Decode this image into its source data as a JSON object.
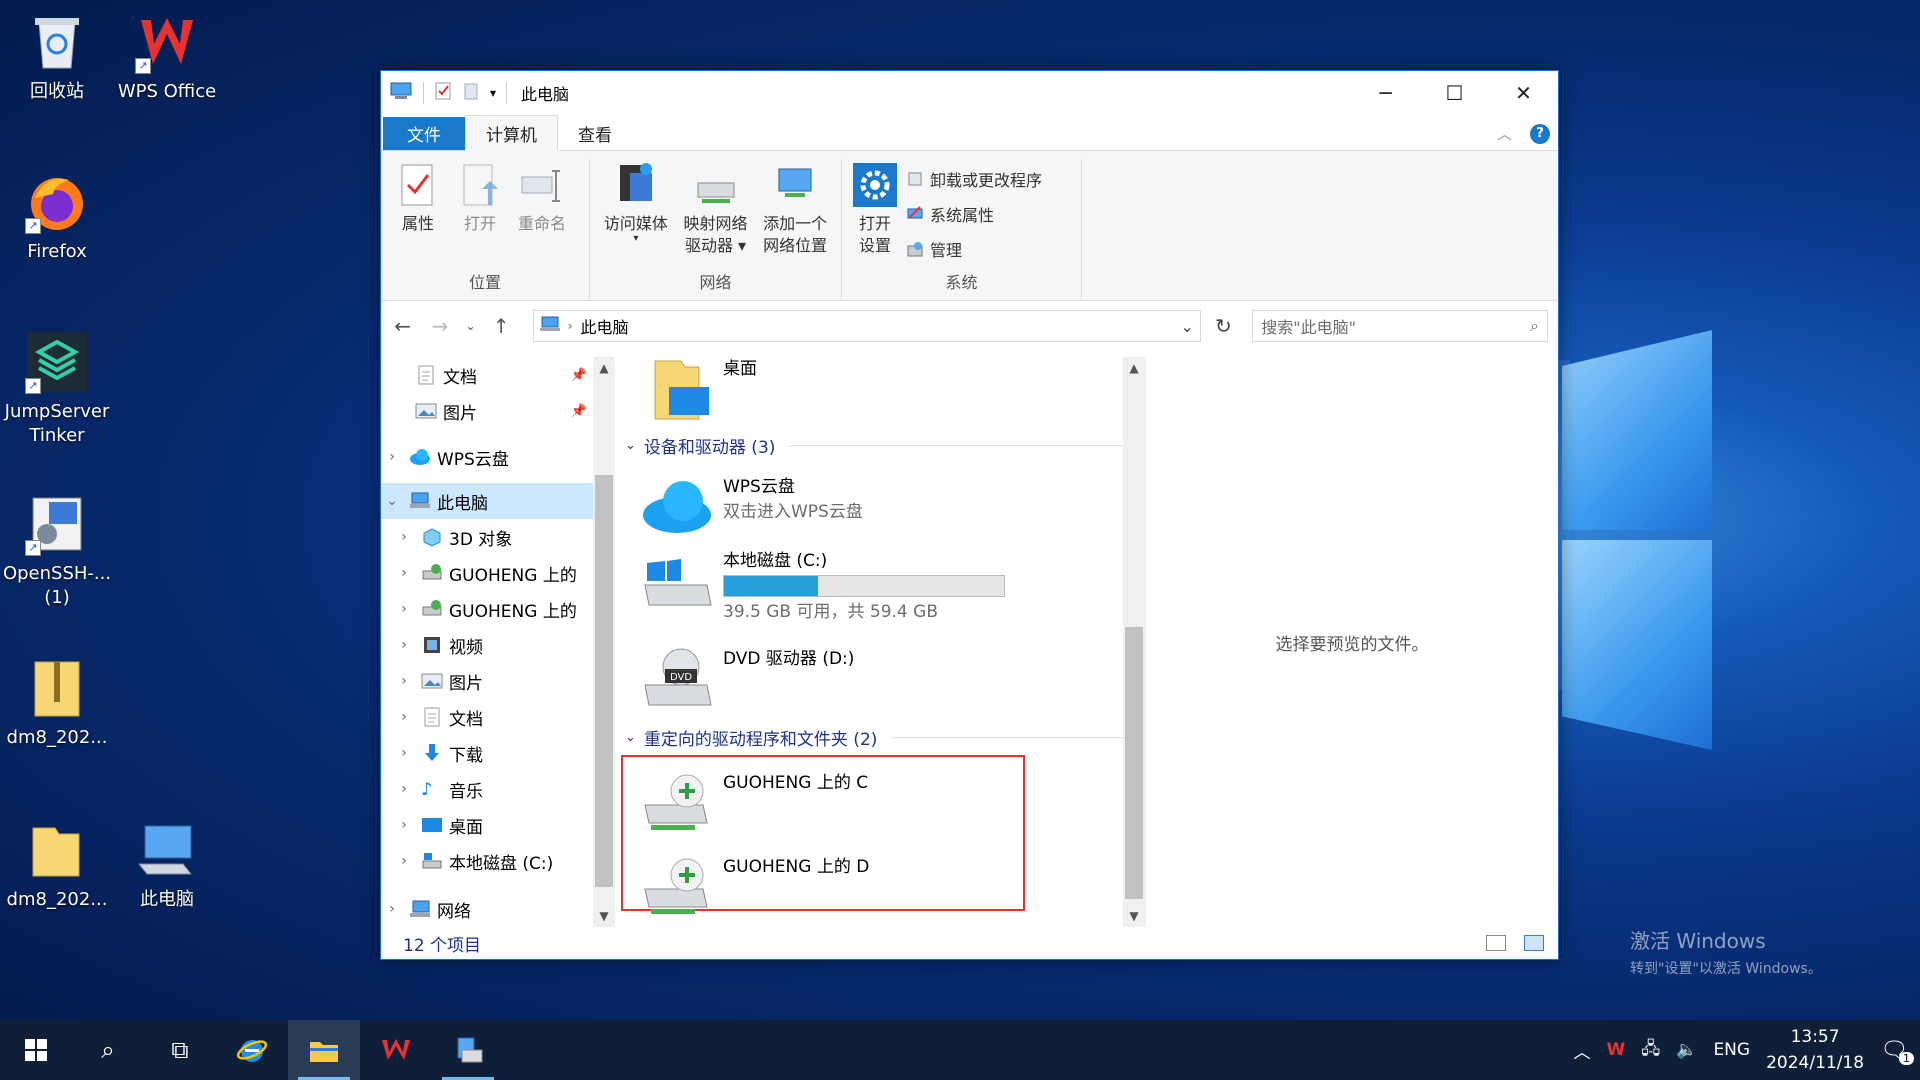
{
  "desktop": {
    "icons": [
      {
        "label": "回收站"
      },
      {
        "label": "WPS Office"
      },
      {
        "label": "Firefox"
      },
      {
        "label": "JumpServer Tinker"
      },
      {
        "label": "OpenSSH-... (1)"
      },
      {
        "label": "dm8_202..."
      },
      {
        "label": "dm8_202..."
      },
      {
        "label": "此电脑"
      }
    ],
    "watermark": {
      "line1": "激活 Windows",
      "line2": "转到\"设置\"以激活 Windows。"
    }
  },
  "window": {
    "title": "此电脑",
    "tabs": {
      "file": "文件",
      "computer": "计算机",
      "view": "查看"
    },
    "ribbon": {
      "location": {
        "label": "位置",
        "properties": "属性",
        "open": "打开",
        "rename": "重命名"
      },
      "network": {
        "label": "网络",
        "media": "访问媒体",
        "map_drive_l1": "映射网络",
        "map_drive_l2": "驱动器",
        "add_loc_l1": "添加一个",
        "add_loc_l2": "网络位置"
      },
      "system": {
        "label": "系统",
        "open_settings_l1": "打开",
        "open_settings_l2": "设置",
        "uninstall": "卸载或更改程序",
        "sys_props": "系统属性",
        "manage": "管理"
      }
    },
    "address": {
      "path": "此电脑",
      "search_placeholder": "搜索\"此电脑\""
    },
    "nav": [
      {
        "label": "文档"
      },
      {
        "label": "图片"
      },
      {
        "label": "WPS云盘"
      },
      {
        "label": "此电脑"
      },
      {
        "label": "3D 对象"
      },
      {
        "label": "GUOHENG 上的"
      },
      {
        "label": "GUOHENG 上的"
      },
      {
        "label": "视频"
      },
      {
        "label": "图片"
      },
      {
        "label": "文档"
      },
      {
        "label": "下载"
      },
      {
        "label": "音乐"
      },
      {
        "label": "桌面"
      },
      {
        "label": "本地磁盘 (C:)"
      },
      {
        "label": "网络"
      }
    ],
    "content": {
      "desktop_folder": "桌面",
      "devices_header": "设备和驱动器 (3)",
      "wps_name": "WPS云盘",
      "wps_sub": "双击进入WPS云盘",
      "c_name": "本地磁盘 (C:)",
      "c_space": "39.5 GB 可用，共 59.4 GB",
      "c_used_fraction": 0.335,
      "dvd_name": "DVD 驱动器 (D:)",
      "redirect_header": "重定向的驱动程序和文件夹 (2)",
      "guoheng_c": "GUOHENG 上的 C",
      "guoheng_d": "GUOHENG 上的 D"
    },
    "preview_text": "选择要预览的文件。",
    "status": "12 个项目"
  },
  "taskbar": {
    "lang": "ENG",
    "time": "13:57",
    "date": "2024/11/18",
    "notif_count": "1"
  }
}
